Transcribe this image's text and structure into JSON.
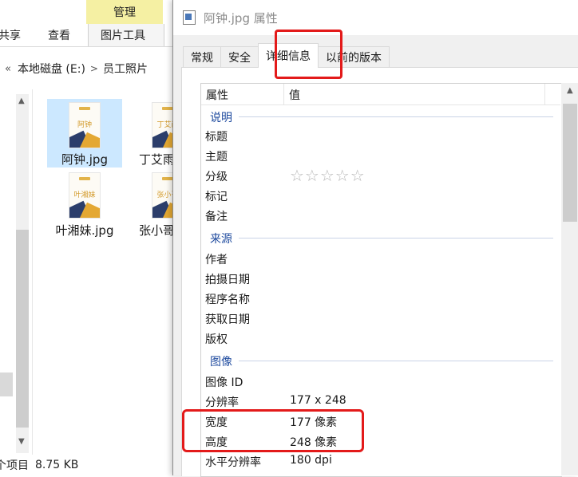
{
  "explorer": {
    "ribbon": {
      "manage_tab": "管理",
      "tabs": [
        "共享",
        "查看",
        "图片工具"
      ]
    },
    "address": {
      "back_glyph": "«",
      "crumbs": [
        "本地磁盘 (E:)",
        "员工照片"
      ],
      "sep_glyph": ">"
    },
    "files": [
      {
        "name": "阿钟.jpg",
        "thumb_text": "阿钟",
        "selected": true
      },
      {
        "name": "丁艾雨",
        "thumb_text": "丁艾雨",
        "selected": false
      },
      {
        "name": "叶湘妹.jpg",
        "thumb_text": "叶湘妹",
        "selected": false
      },
      {
        "name": "张小哥",
        "thumb_text": "张小哥",
        "selected": false
      }
    ],
    "status": {
      "count": "个项目",
      "size": "8.75 KB"
    }
  },
  "dialog": {
    "title": "阿钟.jpg 属性",
    "tabs": [
      "常规",
      "安全",
      "详细信息",
      "以前的版本"
    ],
    "active_tab": 2,
    "columns": {
      "property": "属性",
      "value": "值"
    },
    "groups": {
      "description": "说明",
      "origin": "来源",
      "image": "图像"
    },
    "rows": {
      "title": {
        "k": "标题",
        "v": ""
      },
      "subject": {
        "k": "主题",
        "v": ""
      },
      "rating": {
        "k": "分级",
        "stars": "☆☆☆☆☆",
        "value": 0
      },
      "tags": {
        "k": "标记",
        "v": ""
      },
      "comments": {
        "k": "备注",
        "v": ""
      },
      "author": {
        "k": "作者",
        "v": ""
      },
      "date_taken": {
        "k": "拍摄日期",
        "v": ""
      },
      "program": {
        "k": "程序名称",
        "v": ""
      },
      "date_acquired": {
        "k": "获取日期",
        "v": ""
      },
      "copyright": {
        "k": "版权",
        "v": ""
      },
      "image_id": {
        "k": "图像 ID",
        "v": ""
      },
      "dimensions": {
        "k": "分辨率",
        "v": "177 x 248"
      },
      "width": {
        "k": "宽度",
        "v": "177 像素"
      },
      "height": {
        "k": "高度",
        "v": "248 像素"
      },
      "h_resolution": {
        "k": "水平分辨率",
        "v": "180 dpi"
      }
    }
  },
  "colors": {
    "manage_tab_bg": "#f5f0a3",
    "annotation": "#e31a1a",
    "group_label": "#1e4a9e",
    "selection": "#cce8ff"
  }
}
